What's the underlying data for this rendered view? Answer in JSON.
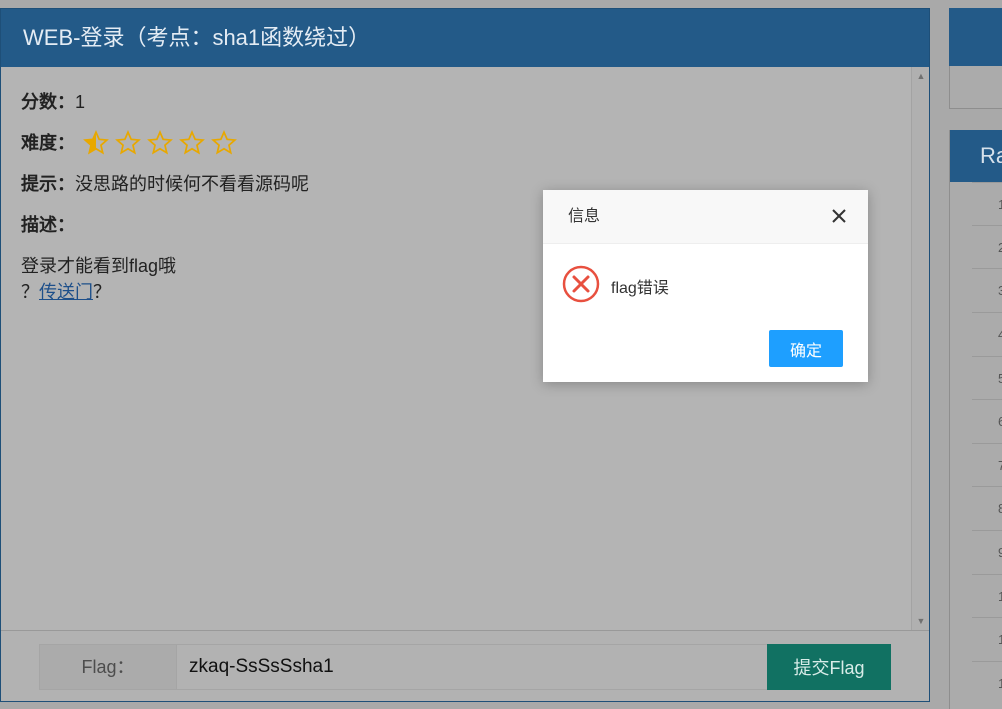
{
  "challenge": {
    "title": "WEB-登录（考点：sha1函数绕过）",
    "score_label": "分数：",
    "score_value": "1",
    "difficulty_label": "难度：",
    "difficulty_rating": 0.5,
    "difficulty_max": 5,
    "hint_label": "提示：",
    "hint_text": "没思路的时候何不看看源码呢",
    "desc_label": "描述：",
    "desc_text": "登录才能看到flag哦",
    "link_prefix": "？",
    "link_text": "传送门",
    "link_suffix": "？"
  },
  "flag_form": {
    "label": "Flag：",
    "value": "zkaq-SsSsSsha1",
    "submit_label": "提交Flag"
  },
  "rank_panel": {
    "title_partial": "Ra",
    "rows": [
      "1",
      "2",
      "3",
      "4",
      "5",
      "6",
      "7",
      "8",
      "9",
      "1",
      "1",
      "1"
    ]
  },
  "dialog": {
    "title": "信息",
    "message": "flag错误",
    "ok_label": "确定"
  },
  "colors": {
    "header_blue": "#235a88",
    "submit_green": "#117162",
    "star_gold": "#e8a800",
    "error_red": "#e8503f",
    "ok_blue": "#1e9fff"
  }
}
